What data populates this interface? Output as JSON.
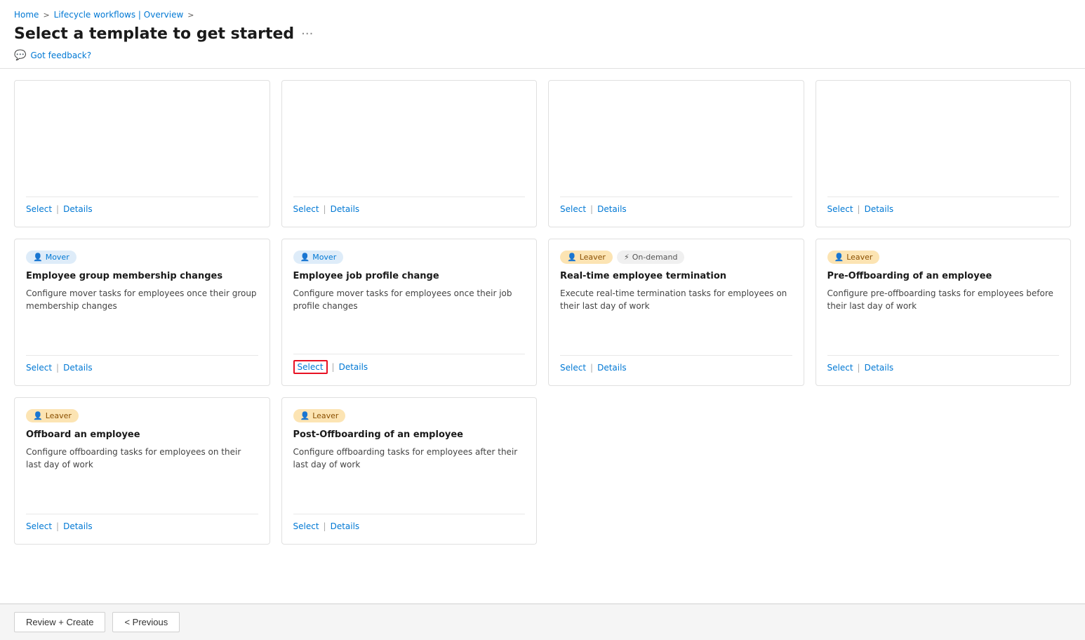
{
  "breadcrumb": {
    "home": "Home",
    "separator1": ">",
    "lifecycle": "Lifecycle workflows | Overview",
    "separator2": ">"
  },
  "page_title": "Select a template to get started",
  "title_more": "···",
  "feedback": {
    "icon": "💬",
    "label": "Got feedback?"
  },
  "cards_row1": [
    {
      "id": "card-r1-1",
      "badges": [],
      "title": "",
      "desc": "",
      "select_label": "Select",
      "details_label": "Details",
      "highlighted": false
    },
    {
      "id": "card-r1-2",
      "badges": [],
      "title": "",
      "desc": "",
      "select_label": "Select",
      "details_label": "Details",
      "highlighted": false
    },
    {
      "id": "card-r1-3",
      "badges": [],
      "title": "",
      "desc": "",
      "select_label": "Select",
      "details_label": "Details",
      "highlighted": false
    },
    {
      "id": "card-r1-4",
      "badges": [],
      "title": "",
      "desc": "",
      "select_label": "Select",
      "details_label": "Details",
      "highlighted": false
    }
  ],
  "cards_row2": [
    {
      "id": "card-mover-group",
      "badges": [
        {
          "type": "mover",
          "label": "Mover",
          "icon": "👤"
        }
      ],
      "title": "Employee group membership changes",
      "desc": "Configure mover tasks for employees once their group membership changes",
      "select_label": "Select",
      "details_label": "Details",
      "highlighted": false
    },
    {
      "id": "card-mover-job",
      "badges": [
        {
          "type": "mover",
          "label": "Mover",
          "icon": "👤"
        }
      ],
      "title": "Employee job profile change",
      "desc": "Configure mover tasks for employees once their job profile changes",
      "select_label": "Select",
      "details_label": "Details",
      "highlighted": true
    },
    {
      "id": "card-leaver-realtime",
      "badges": [
        {
          "type": "leaver",
          "label": "Leaver",
          "icon": "👤"
        },
        {
          "type": "ondemand",
          "label": "On-demand",
          "icon": "⚡"
        }
      ],
      "title": "Real-time employee termination",
      "desc": "Execute real-time termination tasks for employees on their last day of work",
      "select_label": "Select",
      "details_label": "Details",
      "highlighted": false
    },
    {
      "id": "card-leaver-preoffboard",
      "badges": [
        {
          "type": "leaver",
          "label": "Leaver",
          "icon": "👤"
        }
      ],
      "title": "Pre-Offboarding of an employee",
      "desc": "Configure pre-offboarding tasks for employees before their last day of work",
      "select_label": "Select",
      "details_label": "Details",
      "highlighted": false
    }
  ],
  "cards_row3": [
    {
      "id": "card-leaver-offboard",
      "badges": [
        {
          "type": "leaver",
          "label": "Leaver",
          "icon": "👤"
        }
      ],
      "title": "Offboard an employee",
      "desc": "Configure offboarding tasks for employees on their last day of work",
      "select_label": "Select",
      "details_label": "Details",
      "highlighted": false
    },
    {
      "id": "card-leaver-postoffboard",
      "badges": [
        {
          "type": "leaver",
          "label": "Leaver",
          "icon": "👤"
        }
      ],
      "title": "Post-Offboarding of an employee",
      "desc": "Configure offboarding tasks for employees after their last day of work",
      "select_label": "Select",
      "details_label": "Details",
      "highlighted": false
    }
  ],
  "footer": {
    "review_create_label": "Review + Create",
    "previous_label": "< Previous"
  }
}
